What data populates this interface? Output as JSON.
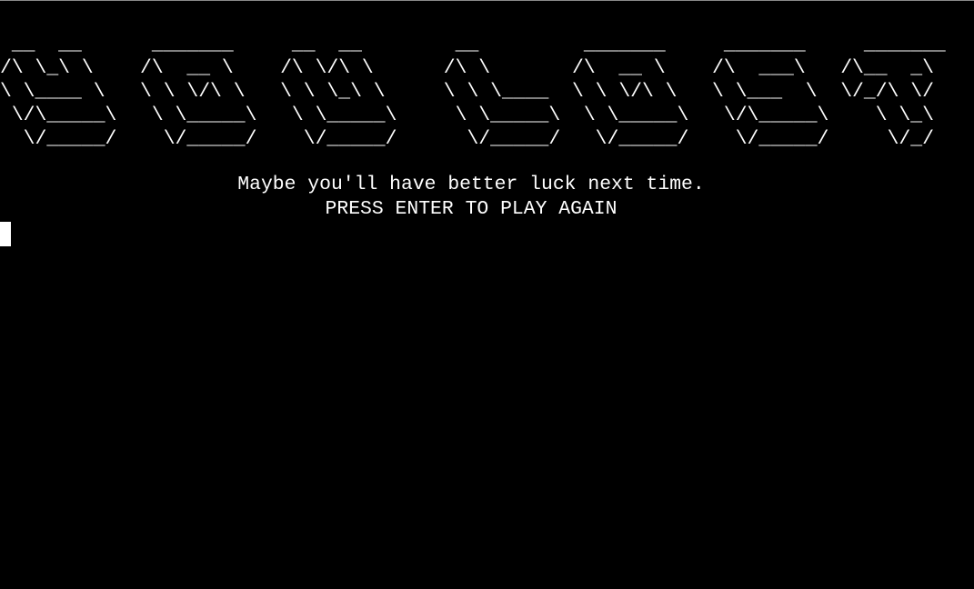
{
  "screen": {
    "title_banner": [
      " __  __      _______     __  __        __         _______     _______     _______  ",
      "/\\ \\_\\ \\    /\\  __ \\    /\\ \\/\\ \\      /\\ \\       /\\  __ \\    /\\  ___\\   /\\__  _\\ ",
      "\\ \\____ \\   \\ \\ \\/\\ \\   \\ \\ \\_\\ \\     \\ \\ \\____  \\ \\ \\/\\ \\   \\ \\___  \\  \\/_/\\ \\/ ",
      " \\/\\_____\\   \\ \\_____\\   \\ \\_____\\     \\ \\_____\\  \\ \\_____\\   \\/\\_____\\    \\ \\_\\ ",
      "  \\/_____/    \\/_____/    \\/_____/      \\/_____/   \\/_____/    \\/_____/     \\/_/ "
    ],
    "message": "Maybe you'll have better luck next time.",
    "prompt": "PRESS ENTER TO PLAY AGAIN"
  },
  "colors": {
    "background": "#000000",
    "text": "#ffffff"
  }
}
